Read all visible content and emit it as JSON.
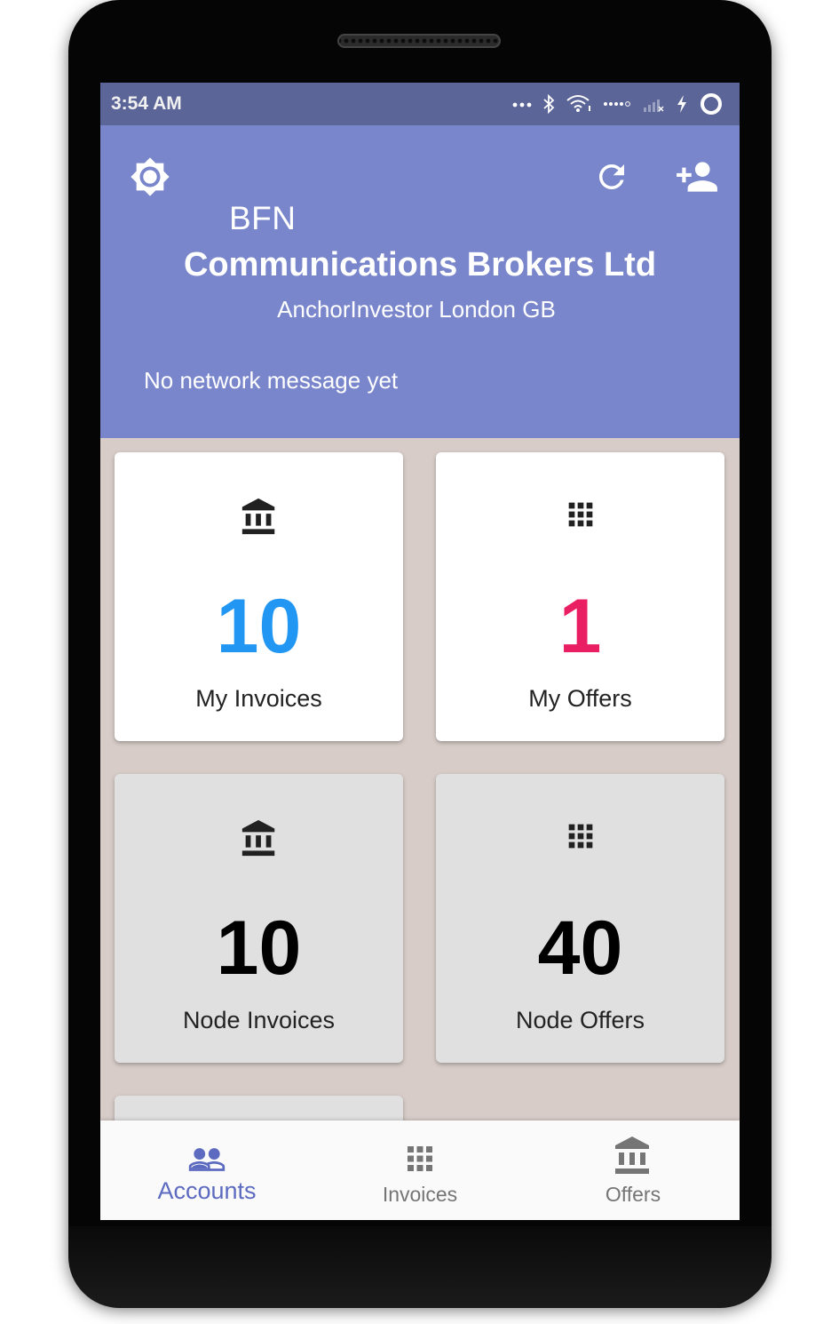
{
  "status_bar": {
    "time": "3:54 AM",
    "icons": [
      "more-dots-icon",
      "bluetooth-icon",
      "wifi-icon",
      "signal-dots-icon",
      "cell-signal-icon",
      "charging-icon",
      "battery-ring-icon"
    ]
  },
  "app_bar": {
    "title": "BFN",
    "company_name": "Communications Brokers Ltd",
    "subtitle": "AnchorInvestor London GB",
    "network_message": "No network message yet",
    "actions": [
      "brightness-icon",
      "refresh-icon",
      "person-add-icon"
    ]
  },
  "dashboard": {
    "cards": [
      {
        "label": "My Invoices",
        "count": "10",
        "icon": "account-balance-icon",
        "count_color": "#2196f3"
      },
      {
        "label": "My Offers",
        "count": "1",
        "icon": "apps-grid-icon",
        "count_color": "#e91e63"
      },
      {
        "label": "Node Invoices",
        "count": "10",
        "icon": "account-balance-icon",
        "count_color": "#000000"
      },
      {
        "label": "Node Offers",
        "count": "40",
        "icon": "apps-grid-icon",
        "count_color": "#000000"
      }
    ]
  },
  "bottom_nav": {
    "items": [
      {
        "label": "Accounts",
        "icon": "people-icon",
        "active": true
      },
      {
        "label": "Invoices",
        "icon": "apps-grid-icon",
        "active": false
      },
      {
        "label": "Offers",
        "icon": "account-balance-icon",
        "active": false
      }
    ]
  },
  "colors": {
    "primary": "#7986cb",
    "status_bar": "#5c6598",
    "background": "#d7ccc8",
    "accent_blue": "#2196f3",
    "accent_pink": "#e91e63",
    "nav_active": "#5c6bc0",
    "nav_inactive": "#757575"
  }
}
